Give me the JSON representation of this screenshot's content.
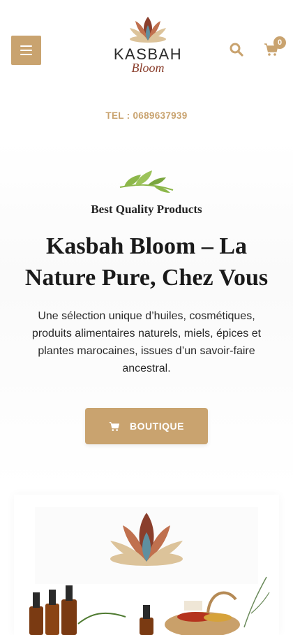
{
  "header": {
    "menu_icon": "hamburger-icon",
    "logo": {
      "brand": "KASBAH",
      "script": "Bloom"
    },
    "search_icon": "search-icon",
    "cart_icon": "cart-icon",
    "cart_count": "0"
  },
  "contact": {
    "tel": "TEL : 0689637939"
  },
  "hero": {
    "tagline": "Best Quality Products",
    "title": "Kasbah Bloom – La Nature Pure, Chez Vous",
    "description": "Une sélection unique d’huiles, cosmétiques, produits alimentaires naturels, miels, épices et plantes marocaines, issues d’un savoir-faire ancestral.",
    "button_label": "BOUTIQUE",
    "button_icon": "cart-icon"
  },
  "colors": {
    "accent": "#c9a36f",
    "lotus_brown": "#8a3e2c",
    "lotus_terracotta": "#c0704e",
    "lotus_sand": "#dcc39a",
    "lotus_blue": "#5f8fa0",
    "leaf_green": "#8cb74a"
  }
}
